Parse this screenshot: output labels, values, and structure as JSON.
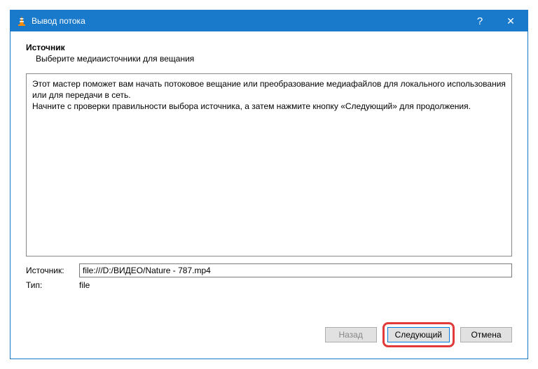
{
  "titlebar": {
    "title": "Вывод потока",
    "help": "?",
    "close": "✕"
  },
  "section": {
    "heading": "Источник",
    "subheading": "Выберите медиаисточники для вещания"
  },
  "wizard": {
    "line1": "Этот мастер поможет вам начать потоковое вещание или преобразование медиафайлов для локального использования или для передачи в сеть.",
    "line2": "Начните с проверки правильности выбора источника, а затем нажмите кнопку «Следующий» для продолжения."
  },
  "form": {
    "source_label": "Источник:",
    "source_value": "file:///D:/ВИДЕО/Nature - 787.mp4",
    "type_label": "Тип:",
    "type_value": "file"
  },
  "buttons": {
    "back": "Назад",
    "next": "Следующий",
    "cancel": "Отмена"
  }
}
